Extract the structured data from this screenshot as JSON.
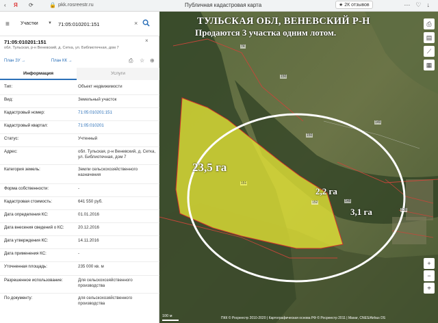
{
  "browser": {
    "url": "pkk.rosreestr.ru",
    "title": "Публичная кадастровая карта",
    "reviews": "★ 2К отзывов"
  },
  "search": {
    "type_label": "Участки",
    "value": "71:05:010201:151"
  },
  "object": {
    "id": "71:05:010201:151",
    "address": "обл. Тульская, р-н Веневский, д. Сетка, ул. Библиотечная, дом 7",
    "plan_zu": "План ЗУ →",
    "plan_kk": "План КК →"
  },
  "tabs": {
    "info": "Информация",
    "services": "Услуги"
  },
  "rows": [
    {
      "k": "Тип:",
      "v": "Объект недвижимости"
    },
    {
      "k": "Вид:",
      "v": "Земельный участок"
    },
    {
      "k": "Кадастровый номер:",
      "v": "71:05:010201:151"
    },
    {
      "k": "Кадастровый квартал:",
      "v": "71:05:010201"
    },
    {
      "k": "Статус:",
      "v": "Учтенный"
    },
    {
      "k": "Адрес:",
      "v": "обл. Тульская, р-н Веневский, д. Сетка, ул. Библиотечная, дом 7"
    },
    {
      "k": "Категория земель:",
      "v": "Земли сельскохозяйственного назначения"
    },
    {
      "k": "Форма собственности:",
      "v": "-"
    },
    {
      "k": "Кадастровая стоимость:",
      "v": "641 550 руб."
    },
    {
      "k": "Дата определения КС:",
      "v": "01.01.2016"
    },
    {
      "k": "Дата внесения сведений о КС:",
      "v": "20.12.2016"
    },
    {
      "k": "Дата утверждения КС:",
      "v": "14.11.2016"
    },
    {
      "k": "Дата применения КС:",
      "v": "-"
    },
    {
      "k": "Уточненная площадь:",
      "v": "235 000 кв. м"
    },
    {
      "k": "Разрешенное использование:",
      "v": "Для сельскохозяйственного производства"
    },
    {
      "k": "По документу:",
      "v": "для сельскохозяйственного производства"
    }
  ],
  "map": {
    "heading": "ТУЛЬСКАЯ ОБЛ, ВЕНЕВСКИЙ Р-Н",
    "subheading": "Продаются 3 участка одним лотом.",
    "area1": "23,5 га",
    "area2": "2,2 га",
    "area3": "3,1 га",
    "parcel_num": "151",
    "nums": [
      "74",
      "150",
      "149",
      "150",
      "152",
      "148",
      "138"
    ],
    "scale": "100 м",
    "copyright": "ПКК © Росреестр 2010-2020 | Картографическая основа РФ © Росреестр 2011 | Maxar, CNES/Airbus DS"
  },
  "colors": {
    "accent": "#2a6fb8",
    "parcel": "#e6e636",
    "parcel_border": "#d0302a"
  }
}
